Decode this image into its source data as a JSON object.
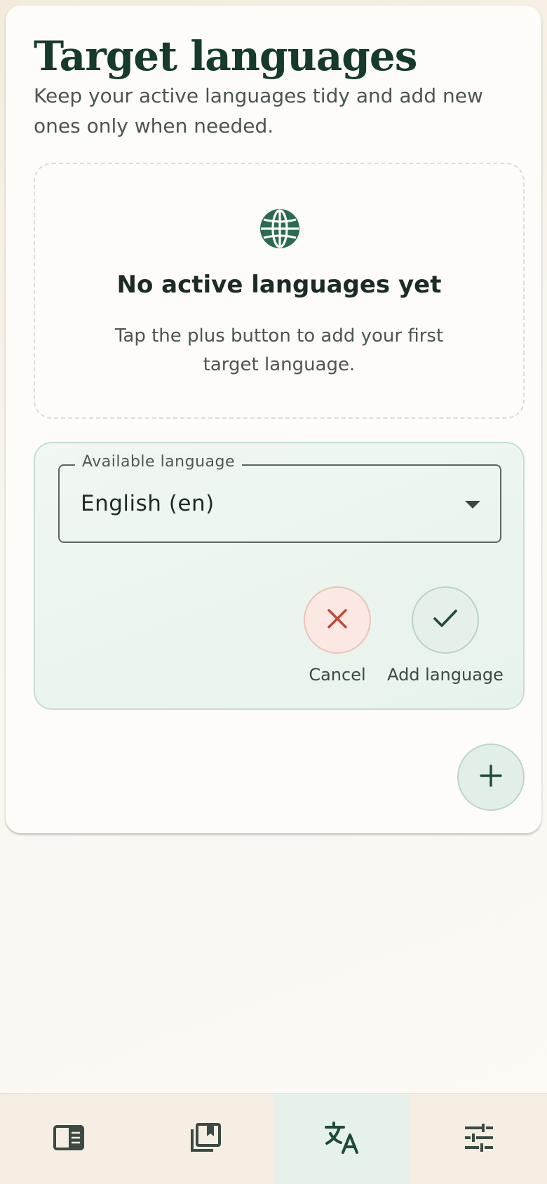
{
  "header": {
    "title": "Target languages",
    "subtitle": "Keep your active languages tidy and add new ones only when needed."
  },
  "empty_state": {
    "icon": "globe-icon",
    "title": "No active languages yet",
    "text": "Tap the plus button to add your first target language."
  },
  "picker": {
    "field_label": "Available language",
    "selected_value": "English (en)",
    "cancel_label": "Cancel",
    "add_label": "Add language"
  },
  "fab": {
    "icon": "plus-icon"
  },
  "nav": {
    "items": [
      {
        "icon": "reader-icon",
        "active": false
      },
      {
        "icon": "library-icon",
        "active": false
      },
      {
        "icon": "translate-icon",
        "active": true
      },
      {
        "icon": "tune-icon",
        "active": false
      }
    ]
  },
  "colors": {
    "accent_green": "#2b6b4e",
    "title_green": "#163a2c",
    "cancel_red": "#c0453a",
    "nav_active_bg": "#e5f1e9"
  }
}
